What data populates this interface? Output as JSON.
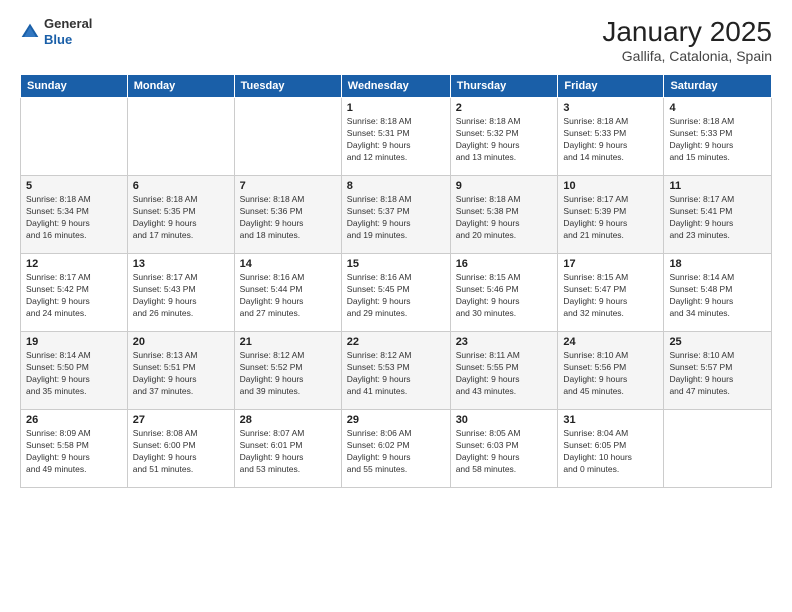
{
  "header": {
    "logo": {
      "line1": "General",
      "line2": "Blue"
    },
    "title": "January 2025",
    "location": "Gallifa, Catalonia, Spain"
  },
  "days_of_week": [
    "Sunday",
    "Monday",
    "Tuesday",
    "Wednesday",
    "Thursday",
    "Friday",
    "Saturday"
  ],
  "weeks": [
    [
      {
        "day": "",
        "info": ""
      },
      {
        "day": "",
        "info": ""
      },
      {
        "day": "",
        "info": ""
      },
      {
        "day": "1",
        "info": "Sunrise: 8:18 AM\nSunset: 5:31 PM\nDaylight: 9 hours\nand 12 minutes."
      },
      {
        "day": "2",
        "info": "Sunrise: 8:18 AM\nSunset: 5:32 PM\nDaylight: 9 hours\nand 13 minutes."
      },
      {
        "day": "3",
        "info": "Sunrise: 8:18 AM\nSunset: 5:33 PM\nDaylight: 9 hours\nand 14 minutes."
      },
      {
        "day": "4",
        "info": "Sunrise: 8:18 AM\nSunset: 5:33 PM\nDaylight: 9 hours\nand 15 minutes."
      }
    ],
    [
      {
        "day": "5",
        "info": "Sunrise: 8:18 AM\nSunset: 5:34 PM\nDaylight: 9 hours\nand 16 minutes."
      },
      {
        "day": "6",
        "info": "Sunrise: 8:18 AM\nSunset: 5:35 PM\nDaylight: 9 hours\nand 17 minutes."
      },
      {
        "day": "7",
        "info": "Sunrise: 8:18 AM\nSunset: 5:36 PM\nDaylight: 9 hours\nand 18 minutes."
      },
      {
        "day": "8",
        "info": "Sunrise: 8:18 AM\nSunset: 5:37 PM\nDaylight: 9 hours\nand 19 minutes."
      },
      {
        "day": "9",
        "info": "Sunrise: 8:18 AM\nSunset: 5:38 PM\nDaylight: 9 hours\nand 20 minutes."
      },
      {
        "day": "10",
        "info": "Sunrise: 8:17 AM\nSunset: 5:39 PM\nDaylight: 9 hours\nand 21 minutes."
      },
      {
        "day": "11",
        "info": "Sunrise: 8:17 AM\nSunset: 5:41 PM\nDaylight: 9 hours\nand 23 minutes."
      }
    ],
    [
      {
        "day": "12",
        "info": "Sunrise: 8:17 AM\nSunset: 5:42 PM\nDaylight: 9 hours\nand 24 minutes."
      },
      {
        "day": "13",
        "info": "Sunrise: 8:17 AM\nSunset: 5:43 PM\nDaylight: 9 hours\nand 26 minutes."
      },
      {
        "day": "14",
        "info": "Sunrise: 8:16 AM\nSunset: 5:44 PM\nDaylight: 9 hours\nand 27 minutes."
      },
      {
        "day": "15",
        "info": "Sunrise: 8:16 AM\nSunset: 5:45 PM\nDaylight: 9 hours\nand 29 minutes."
      },
      {
        "day": "16",
        "info": "Sunrise: 8:15 AM\nSunset: 5:46 PM\nDaylight: 9 hours\nand 30 minutes."
      },
      {
        "day": "17",
        "info": "Sunrise: 8:15 AM\nSunset: 5:47 PM\nDaylight: 9 hours\nand 32 minutes."
      },
      {
        "day": "18",
        "info": "Sunrise: 8:14 AM\nSunset: 5:48 PM\nDaylight: 9 hours\nand 34 minutes."
      }
    ],
    [
      {
        "day": "19",
        "info": "Sunrise: 8:14 AM\nSunset: 5:50 PM\nDaylight: 9 hours\nand 35 minutes."
      },
      {
        "day": "20",
        "info": "Sunrise: 8:13 AM\nSunset: 5:51 PM\nDaylight: 9 hours\nand 37 minutes."
      },
      {
        "day": "21",
        "info": "Sunrise: 8:12 AM\nSunset: 5:52 PM\nDaylight: 9 hours\nand 39 minutes."
      },
      {
        "day": "22",
        "info": "Sunrise: 8:12 AM\nSunset: 5:53 PM\nDaylight: 9 hours\nand 41 minutes."
      },
      {
        "day": "23",
        "info": "Sunrise: 8:11 AM\nSunset: 5:55 PM\nDaylight: 9 hours\nand 43 minutes."
      },
      {
        "day": "24",
        "info": "Sunrise: 8:10 AM\nSunset: 5:56 PM\nDaylight: 9 hours\nand 45 minutes."
      },
      {
        "day": "25",
        "info": "Sunrise: 8:10 AM\nSunset: 5:57 PM\nDaylight: 9 hours\nand 47 minutes."
      }
    ],
    [
      {
        "day": "26",
        "info": "Sunrise: 8:09 AM\nSunset: 5:58 PM\nDaylight: 9 hours\nand 49 minutes."
      },
      {
        "day": "27",
        "info": "Sunrise: 8:08 AM\nSunset: 6:00 PM\nDaylight: 9 hours\nand 51 minutes."
      },
      {
        "day": "28",
        "info": "Sunrise: 8:07 AM\nSunset: 6:01 PM\nDaylight: 9 hours\nand 53 minutes."
      },
      {
        "day": "29",
        "info": "Sunrise: 8:06 AM\nSunset: 6:02 PM\nDaylight: 9 hours\nand 55 minutes."
      },
      {
        "day": "30",
        "info": "Sunrise: 8:05 AM\nSunset: 6:03 PM\nDaylight: 9 hours\nand 58 minutes."
      },
      {
        "day": "31",
        "info": "Sunrise: 8:04 AM\nSunset: 6:05 PM\nDaylight: 10 hours\nand 0 minutes."
      },
      {
        "day": "",
        "info": ""
      }
    ]
  ]
}
